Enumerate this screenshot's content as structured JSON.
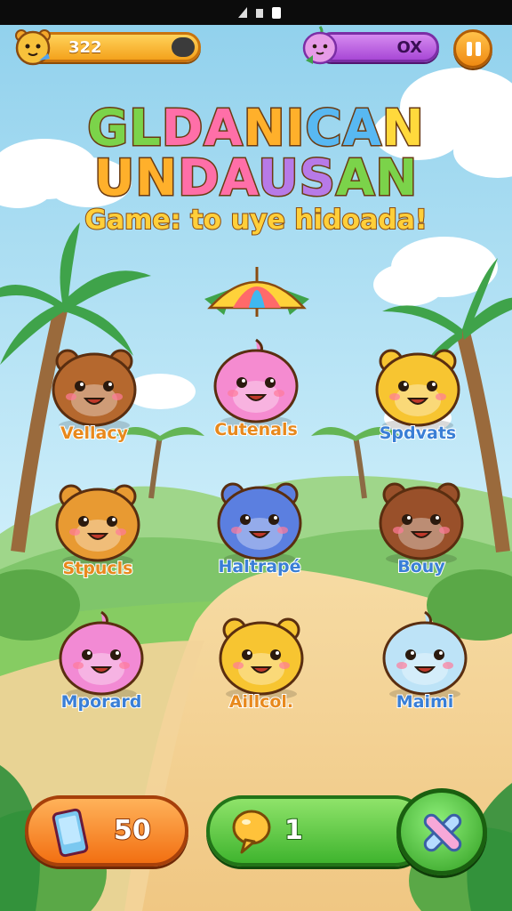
{
  "hud": {
    "score": "322",
    "combo": "OX"
  },
  "title": {
    "line1": [
      "GL",
      "DA",
      "NI",
      "CA",
      "N"
    ],
    "line2": [
      "UN",
      "DA",
      "US",
      "AN"
    ],
    "subtitle": "Game: to uye hidoada!"
  },
  "critters": [
    {
      "name": "Vellacy",
      "icon": "brown-bear-icon",
      "color": "#b5682e"
    },
    {
      "name": "Cutenals",
      "icon": "pink-blob-icon",
      "color": "#f58bd0"
    },
    {
      "name": "Spdvats",
      "icon": "yellow-bear-icon",
      "color": "#f7c531"
    },
    {
      "name": "Stpucls",
      "icon": "orange-bear-icon",
      "color": "#e89a32"
    },
    {
      "name": "Haltrapé",
      "icon": "blue-bear-icon",
      "color": "#5b7fe0"
    },
    {
      "name": "Bouy",
      "icon": "dark-brown-bear-icon",
      "color": "#99502a"
    },
    {
      "name": "Mporard",
      "icon": "pink-whale-icon",
      "color": "#f28ad4"
    },
    {
      "name": "Aillcol.",
      "icon": "yellow-bear-icon",
      "color": "#f7c531"
    },
    {
      "name": "Maimi",
      "icon": "light-blue-seal-icon",
      "color": "#bde3f7"
    }
  ],
  "bottom_bar": {
    "coins": "50",
    "hints": "1"
  }
}
